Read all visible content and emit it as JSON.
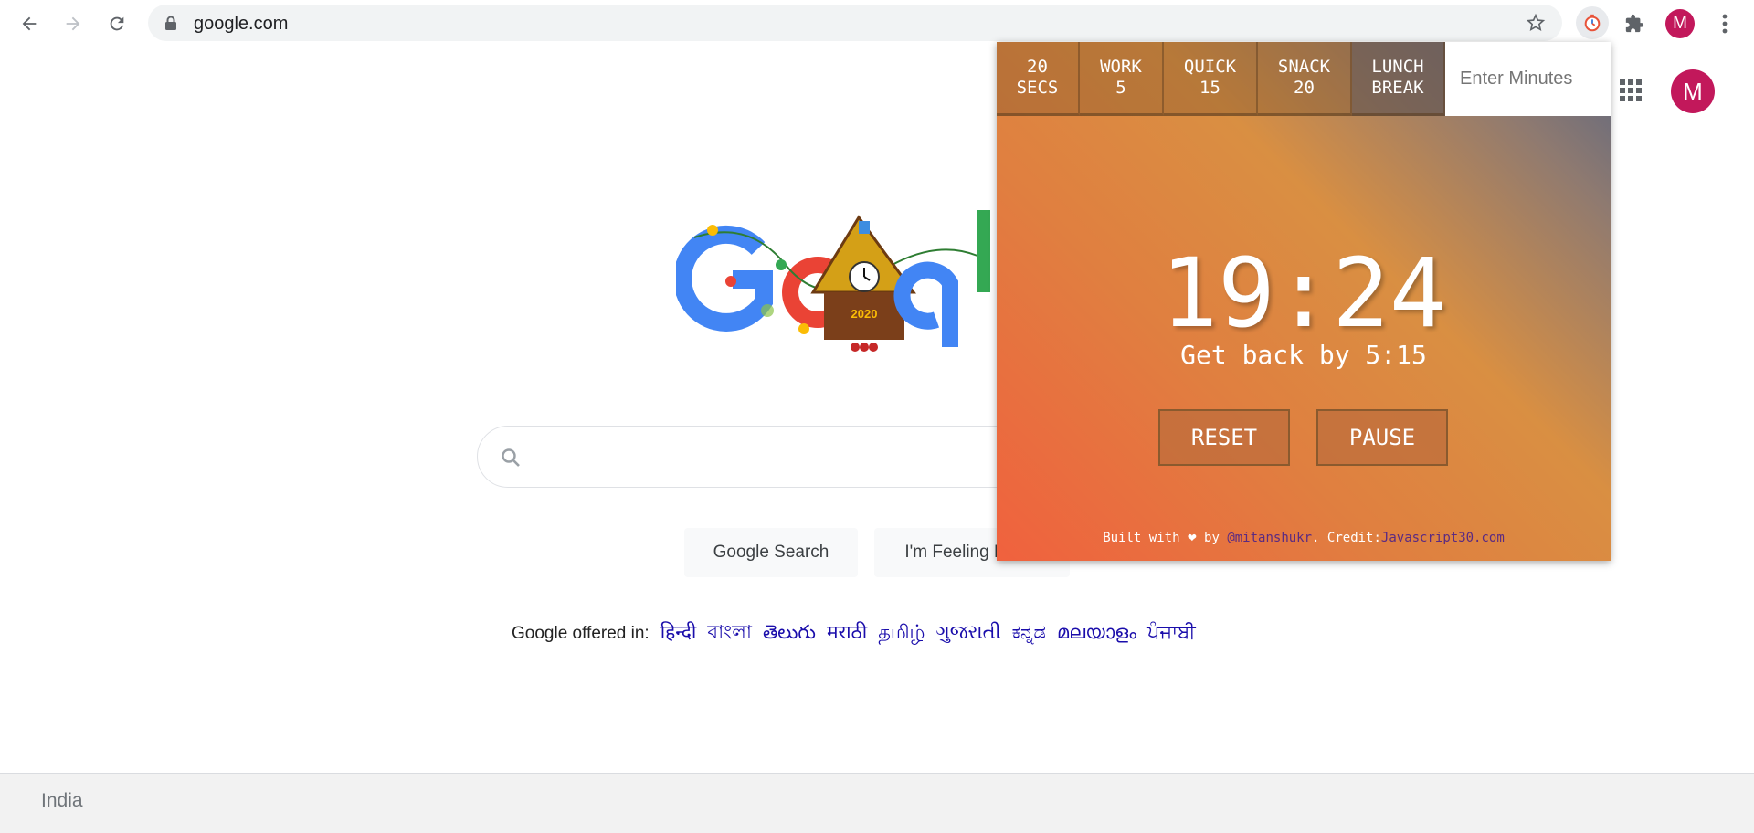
{
  "browser": {
    "url": "google.com",
    "profile_initial": "M",
    "icons": [
      "back-icon",
      "forward-icon",
      "reload-icon",
      "lock-icon",
      "star-icon",
      "timer-extension-icon",
      "extensions-icon",
      "more-icon"
    ]
  },
  "google": {
    "avatar_initial": "M",
    "search_button": "Google Search",
    "lucky_button": "I'm Feeling Lucky",
    "offered_label": "Google offered in:",
    "languages": [
      "हिन्दी",
      "বাংলা",
      "తెలుగు",
      "मराठी",
      "தமிழ்",
      "ગુજરાતી",
      "ಕನ್ನಡ",
      "മലയാളം",
      "ਪੰਜਾਬੀ"
    ],
    "doodle_year": "2020",
    "footer_country": "India"
  },
  "timer": {
    "presets": [
      {
        "line1": "20",
        "line2": "SECS"
      },
      {
        "line1": "WORK",
        "line2": "5"
      },
      {
        "line1": "QUICK",
        "line2": "15"
      },
      {
        "line1": "SNACK",
        "line2": "20"
      },
      {
        "line1": "LUNCH",
        "line2": "BREAK"
      }
    ],
    "input_placeholder": "Enter Minutes",
    "time_left": "19:24",
    "end_time": "Get back by 5:15",
    "reset_label": "RESET",
    "pause_label": "PAUSE",
    "credits": {
      "built_with": "Built with",
      "by": "by",
      "author": "@mitanshukr",
      "credit_label": ". Credit:",
      "credit_link": "Javascript30.com"
    }
  },
  "colors": {
    "avatar": "#c2185b",
    "link": "#1a0dab",
    "popup_gradient_start": "#f0613e",
    "popup_gradient_end": "#5b6680"
  }
}
